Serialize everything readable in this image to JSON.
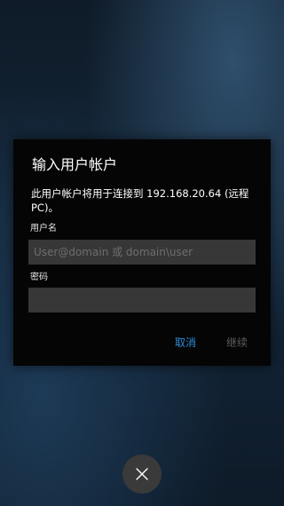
{
  "dialog": {
    "title": "输入用户帐户",
    "message": "此用户帐户将用于连接到 192.168.20.64 (远程 PC)。",
    "username": {
      "label": "用户名",
      "placeholder": "User@domain 或 domain\\user",
      "value": ""
    },
    "password": {
      "label": "密码",
      "value": ""
    },
    "buttons": {
      "cancel": "取消",
      "continue": "继续"
    }
  },
  "close_button": {
    "icon": "close-icon"
  },
  "colors": {
    "dialog_background": "#050505",
    "input_background": "#373737",
    "accent": "#2e8ddb",
    "disabled_text": "#5d5d5d",
    "close_button_background": "#3a3a3a"
  }
}
